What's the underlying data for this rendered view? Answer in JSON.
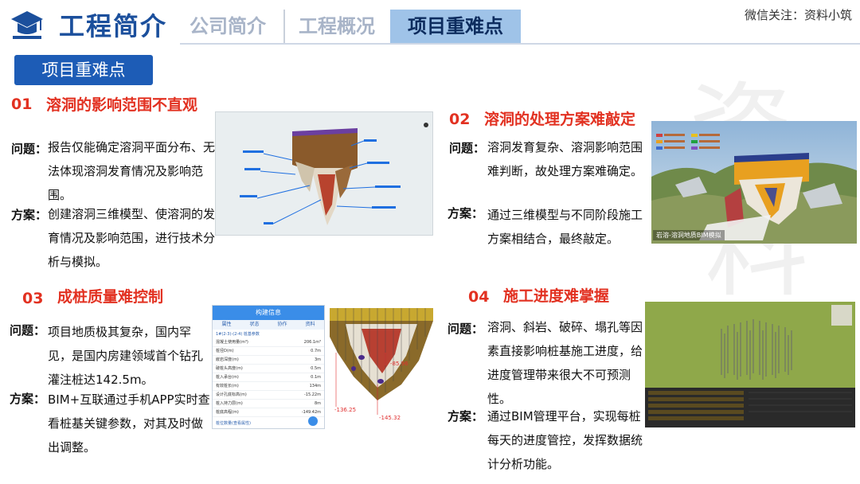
{
  "header": {
    "title": "工程简介",
    "tabs": [
      "公司简介",
      "工程概况",
      "项目重难点"
    ],
    "wechat": "微信关注：资料小筑"
  },
  "watermark": "资料小筑",
  "section_label": "项目重难点",
  "items": [
    {
      "num": "01",
      "title": "溶洞的影响范围不直观",
      "q_label": "问题：",
      "question": "报告仅能确定溶洞平面分布、无法体现溶洞发育情况及影响范围。",
      "a_label": "方案：",
      "answer": "创建溶洞三维模型、使溶洞的发育情况及影响范围，进行技术分析与模拟。"
    },
    {
      "num": "02",
      "title": "溶洞的处理方案难敲定",
      "q_label": "问题：",
      "question": "溶洞发育复杂、溶洞影响范围难判断，故处理方案难确定。",
      "a_label": "方案：",
      "answer": "通过三维模型与不同阶段施工方案相结合，最终敲定。",
      "image_caption": "岩溶-溶洞地质BIM模拟"
    },
    {
      "num": "03",
      "title": "成桩质量难控制",
      "q_label": "问题：",
      "question": "项目地质极其复杂，国内罕见，是国内房建领域首个钻孔灌注桩达142.5m。",
      "a_label": "方案：",
      "answer": "BIM+互联通过手机APP实时查看桩基关键参数，对其及时做出调整。",
      "phone": {
        "header": "构建信息",
        "tabs": [
          "属性",
          "状态",
          "协作",
          "资料"
        ],
        "section": "1#(2-3)-(2-4) 桩基参数",
        "rows": [
          [
            "混凝土使用量(m³)",
            "206.1m³"
          ],
          [
            "桩径D(m)",
            "0.7m"
          ],
          [
            "嵌岩深度(m)",
            "3m"
          ],
          [
            "破桩头高度(m)",
            "0.5m"
          ],
          [
            "桩入承台(m)",
            "0.1m"
          ],
          [
            "有效桩长(m)",
            "134m"
          ],
          [
            "设计孔底标高(m)",
            "-15.22m"
          ],
          [
            "桩入持力层(m)",
            "8m"
          ],
          [
            "桩底高程(m)",
            "-149.42m"
          ]
        ],
        "footer": "桩位数量(查看属性)"
      },
      "labels": [
        "-85.96",
        "-136.25",
        "-145.32"
      ]
    },
    {
      "num": "04",
      "title": "施工进度难掌握",
      "q_label": "问题：",
      "question": "溶洞、斜岩、破碎、塌孔等因素直接影响桩基施工进度，给进度管理带来很大不可预测性。",
      "a_label": "方案：",
      "answer": "通过BIM管理平台，实现每桩每天的进度管控，发挥数据统计分析功能。"
    }
  ]
}
